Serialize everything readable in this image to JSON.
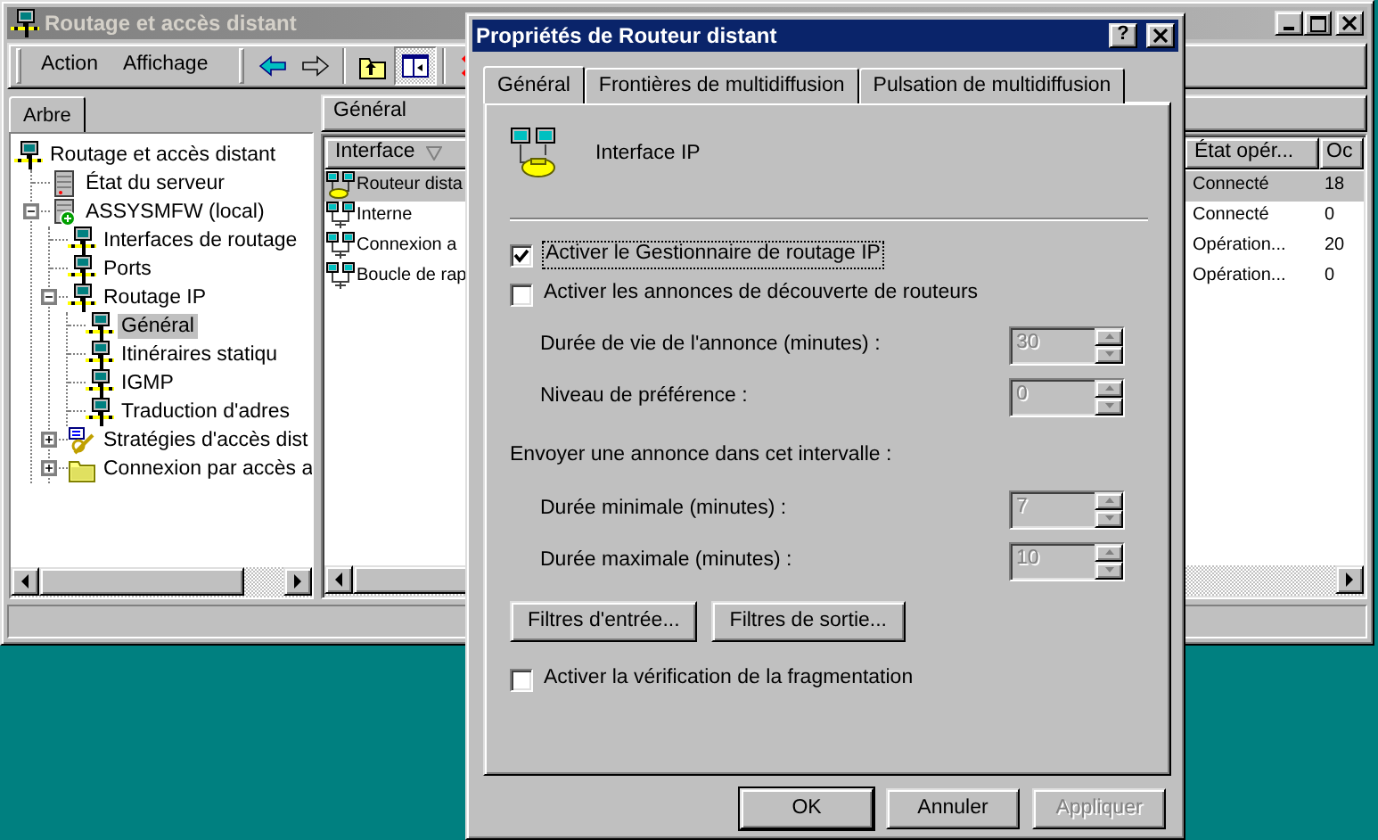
{
  "main_window": {
    "title": "Routage et accès distant",
    "active": false
  },
  "menu": [
    {
      "label": "Action"
    },
    {
      "label": "Affichage"
    }
  ],
  "toolbar": [
    {
      "kind": "back",
      "disabled": false,
      "pressed": false
    },
    {
      "kind": "forward",
      "disabled": true,
      "pressed": false
    },
    {
      "kind": "up",
      "disabled": false,
      "pressed": false
    },
    {
      "kind": "tree",
      "disabled": false,
      "pressed": true
    },
    {
      "kind": "delete",
      "disabled": false,
      "pressed": false
    }
  ],
  "tree_tab": {
    "label": "Arbre"
  },
  "tree": [
    {
      "label": "Routage et accès distant",
      "kind": "computer",
      "selected": false,
      "children": [
        {
          "label": "État du serveur",
          "kind": "server",
          "selected": false
        },
        {
          "label": "ASSYSMFW (local)",
          "kind": "server_local",
          "selected": false,
          "expanded": true,
          "children": [
            {
              "label": "Interfaces de routage",
              "kind": "computer",
              "selected": false
            },
            {
              "label": "Ports",
              "kind": "computer",
              "selected": false
            },
            {
              "label": "Routage IP",
              "kind": "computer",
              "selected": false,
              "expanded": true,
              "children": [
                {
                  "label": "Général",
                  "kind": "computer",
                  "selected": true
                },
                {
                  "label": "Itinéraires statiqu",
                  "kind": "computer",
                  "selected": false
                },
                {
                  "label": "IGMP",
                  "kind": "computer",
                  "selected": false
                },
                {
                  "label": "Traduction d'adres",
                  "kind": "computer",
                  "selected": false
                }
              ]
            },
            {
              "label": "Stratégies d'accès dist",
              "kind": "policy",
              "selected": false,
              "expanded": false
            },
            {
              "label": "Connexion par accès a",
              "kind": "folder",
              "selected": false,
              "expanded": false
            }
          ]
        }
      ]
    }
  ],
  "details": {
    "header": "Général",
    "columns": [
      {
        "label": "Interface",
        "sorted": true
      },
      {
        "label": "État opér..."
      },
      {
        "label": "Oc"
      }
    ],
    "rows": [
      {
        "interface": "Routeur dista",
        "state": "Connecté",
        "column_3": "18",
        "kind": "demand_dial",
        "selected": true
      },
      {
        "interface": "Interne",
        "state": "Connecté",
        "column_3": "0",
        "kind": "lan",
        "selected": false
      },
      {
        "interface": "Connexion a",
        "state": "Opération...",
        "column_3": "20",
        "kind": "lan",
        "selected": false
      },
      {
        "interface": "Boucle de rap",
        "state": "Opération...",
        "column_3": "0",
        "kind": "lan",
        "selected": false
      }
    ]
  },
  "dialog": {
    "title": "Propriétés de Routeur distant",
    "active": true,
    "help": "?",
    "tabs": [
      {
        "label": "Général",
        "selected": true
      },
      {
        "label": "Frontières de multidiffusion",
        "selected": false
      },
      {
        "label": "Pulsation de multidiffusion",
        "selected": false
      }
    ],
    "heading": "Interface IP",
    "items": [
      {
        "kind": "checkbox",
        "label": "Activer le Gestionnaire de routage IP",
        "checked": true,
        "focused": true
      },
      {
        "kind": "checkbox",
        "label": "Activer les annonces de découverte de routeurs",
        "checked": false,
        "focused": false
      },
      {
        "kind": "spin",
        "label": "Durée de vie de l'annonce (minutes) :",
        "value": "30",
        "disabled": true
      },
      {
        "kind": "spin",
        "label": "Niveau de préférence :",
        "value": "0",
        "disabled": true
      },
      {
        "kind": "caption",
        "label": "Envoyer une annonce dans cet intervalle :"
      },
      {
        "kind": "spin",
        "label": "Durée minimale (minutes) :",
        "value": "7",
        "disabled": true
      },
      {
        "kind": "spin",
        "label": "Durée maximale (minutes) :",
        "value": "10",
        "disabled": true
      },
      {
        "kind": "buttons",
        "buttons": [
          {
            "label": "Filtres d'entrée..."
          },
          {
            "label": "Filtres de sortie..."
          }
        ]
      },
      {
        "kind": "checkbox",
        "label": "Activer la vérification de la fragmentation",
        "checked": false,
        "focused": false
      }
    ],
    "buttons": [
      {
        "label": "OK",
        "default": true,
        "disabled": false
      },
      {
        "label": "Annuler",
        "default": false,
        "disabled": false
      },
      {
        "label": "Appliquer",
        "default": false,
        "disabled": true
      }
    ]
  }
}
